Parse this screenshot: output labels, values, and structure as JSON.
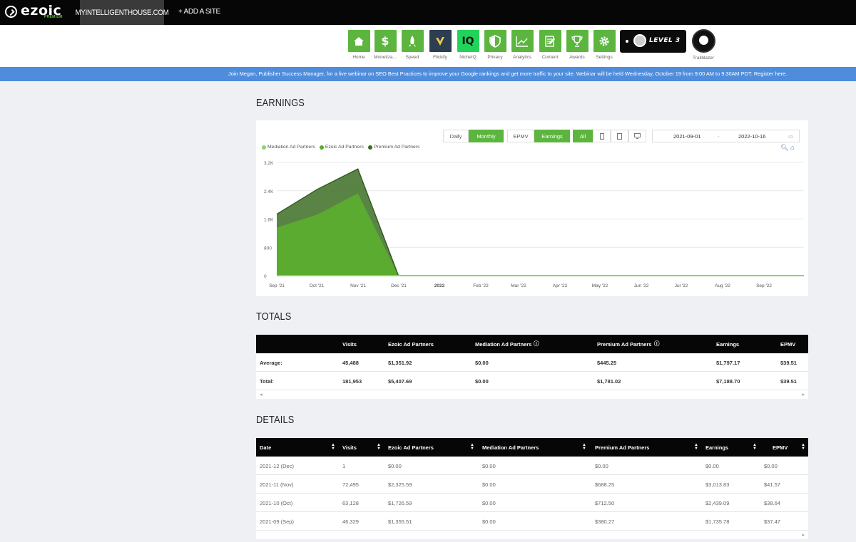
{
  "topbar": {
    "logo_text": "ezoic",
    "logo_sub": "PREMIUM",
    "site_name": "MYINTELLIGENTHOUSE.COM",
    "add_site": "+ ADD A SITE"
  },
  "nav": {
    "items": [
      {
        "label": "Home",
        "icon": "home-icon"
      },
      {
        "label": "Monetiza...",
        "icon": "dollar-icon"
      },
      {
        "label": "Speed",
        "icon": "rocket-icon"
      },
      {
        "label": "Flickify",
        "icon": "flickify-icon"
      },
      {
        "label": "NicheIQ",
        "icon": "iq-icon",
        "icon_text": "IQ"
      },
      {
        "label": "Privacy",
        "icon": "shield-icon"
      },
      {
        "label": "Analytics",
        "icon": "analytics-icon"
      },
      {
        "label": "Content",
        "icon": "content-icon"
      },
      {
        "label": "Awards",
        "icon": "trophy-icon"
      },
      {
        "label": "Settings",
        "icon": "gear-icon"
      }
    ],
    "level": "LEVEL 3",
    "trailblazer": "Trailblazer"
  },
  "banner": {
    "text": "Join Megan, Publisher Success Manager, for a live webinar on SEO Best Practices to improve your Google rankings and get more traffic to your site. Webinar will be held Wednesday, October 19 from 9:00 AM to 9:30AM PDT. ",
    "link": "Register here."
  },
  "earnings": {
    "title": "EARNINGS",
    "toggles": {
      "daily": "Daily",
      "monthly": "Monthly",
      "epmv": "EPMV",
      "earnings": "Earnings",
      "all": "All"
    },
    "date_from": "2021-09-01",
    "date_sep": "-",
    "date_to": "2022-10-16",
    "colors": {
      "mediation": "#8cd26a",
      "ezoic": "#5aab2f",
      "premium": "#3d6f26"
    }
  },
  "chart_data": {
    "type": "area",
    "categories": [
      "Sep '21",
      "Oct '21",
      "Nov '21",
      "Dec '21",
      "2022",
      "Feb '22",
      "Mar '22",
      "Apr '22",
      "May '22",
      "Jun '22",
      "Jul '22",
      "Aug '22",
      "Sep '22"
    ],
    "series": [
      {
        "name": "Mediation Ad Partners",
        "values": [
          0,
          0,
          0,
          0,
          0,
          0,
          0,
          0,
          0,
          0,
          0,
          0,
          0,
          0
        ]
      },
      {
        "name": "Ezoic Ad Partners",
        "values": [
          1355.51,
          1726.59,
          2325.59,
          0,
          0,
          0,
          0,
          0,
          0,
          0,
          0,
          0,
          0,
          0
        ]
      },
      {
        "name": "Premium Ad Partners",
        "values": [
          380.27,
          712.5,
          688.25,
          0,
          0,
          0,
          0,
          0,
          0,
          0,
          0,
          0,
          0,
          0
        ]
      }
    ],
    "yticks": [
      "3.2K",
      "2.4K",
      "1.6K",
      "800",
      "0"
    ],
    "ylim": [
      0,
      3200
    ]
  },
  "totals": {
    "title": "TOTALS",
    "headers": [
      "Visits",
      "Ezoic Ad Partners",
      "Mediation Ad Partners",
      "Premium Ad Partners",
      "Earnings",
      "EPMV"
    ],
    "rows": [
      {
        "label": "Average:",
        "values": [
          "45,488",
          "$1,351.92",
          "$0.00",
          "$445.25",
          "$1,797.17",
          "$39.51"
        ]
      },
      {
        "label": "Total:",
        "values": [
          "181,953",
          "$5,407.69",
          "$0.00",
          "$1,781.02",
          "$7,188.70",
          "$39.51"
        ]
      }
    ]
  },
  "details": {
    "title": "DETAILS",
    "headers": [
      "Date",
      "Visits",
      "Ezoic Ad Partners",
      "Mediation Ad Partners",
      "Premium Ad Partners",
      "Earnings",
      "EPMV"
    ],
    "rows": [
      [
        "2021-12 (Dec)",
        "1",
        "$0.00",
        "$0.00",
        "$0.00",
        "$0.00",
        "$0.00"
      ],
      [
        "2021-11 (Nov)",
        "72,495",
        "$2,325.59",
        "$0.00",
        "$688.25",
        "$3,013.83",
        "$41.57"
      ],
      [
        "2021-10 (Oct)",
        "63,128",
        "$1,726.59",
        "$0.00",
        "$712.50",
        "$2,439.09",
        "$38.64"
      ],
      [
        "2021-09 (Sep)",
        "46,329",
        "$1,355.51",
        "$0.00",
        "$380.27",
        "$1,735.78",
        "$37.47"
      ]
    ]
  }
}
